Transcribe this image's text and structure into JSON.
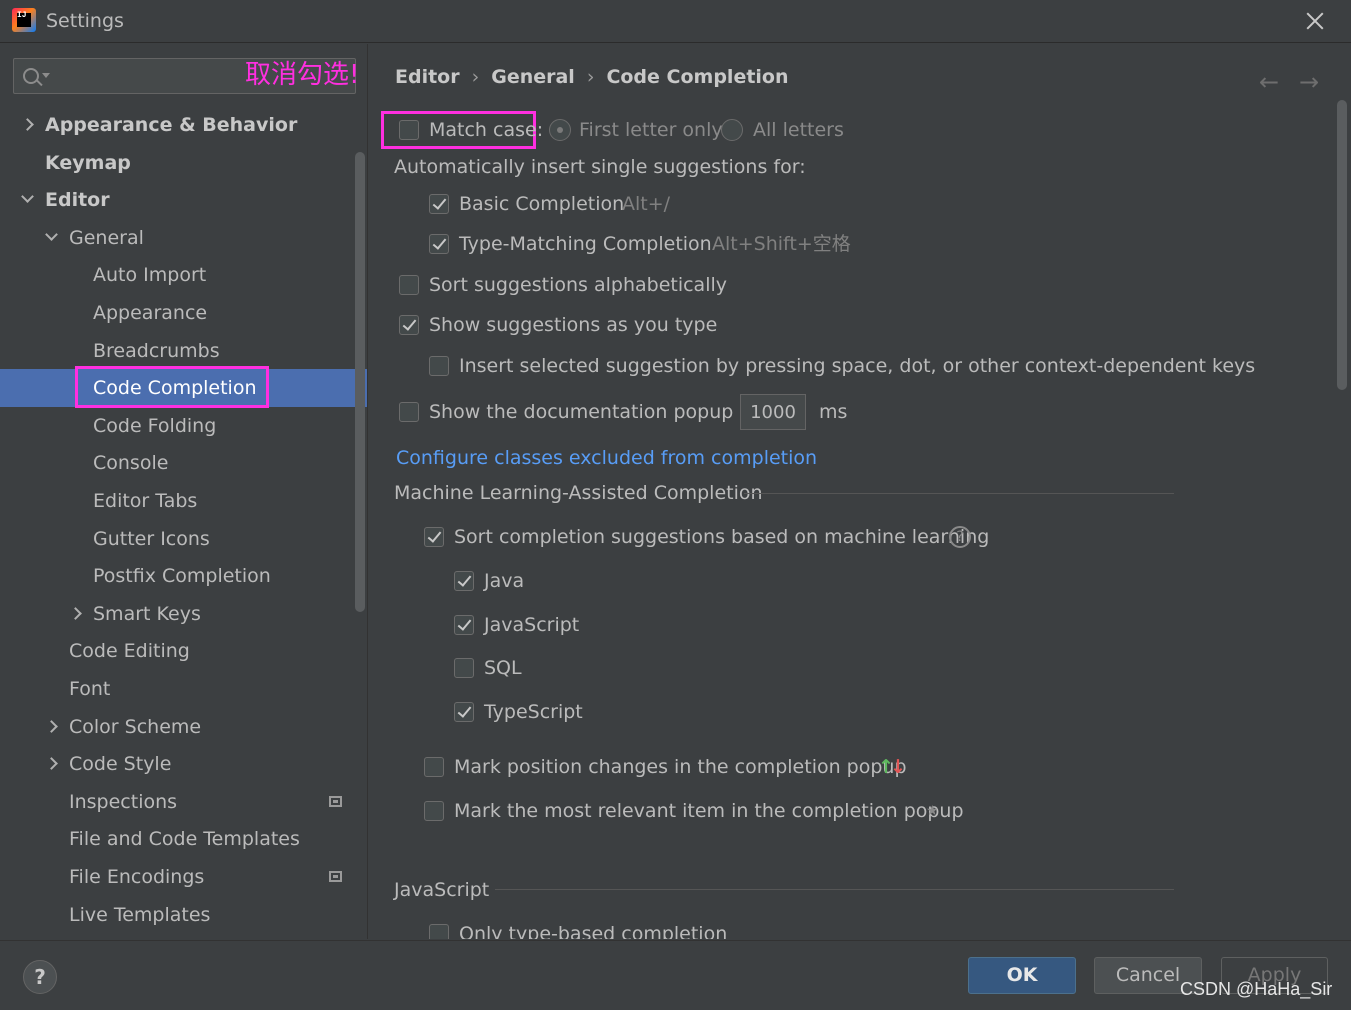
{
  "window": {
    "title": "Settings",
    "app_icon_text": "IJ"
  },
  "annotation": "取消勾选!",
  "search": {
    "value": "",
    "placeholder": ""
  },
  "tree": [
    {
      "label": "Appearance & Behavior",
      "arrow": "right",
      "bold": true
    },
    {
      "label": "Keymap",
      "bold": true
    },
    {
      "label": "Editor",
      "arrow": "down",
      "bold": true
    },
    {
      "label": "General",
      "arrow": "down"
    },
    {
      "label": "Auto Import"
    },
    {
      "label": "Appearance"
    },
    {
      "label": "Breadcrumbs"
    },
    {
      "label": "Code Completion",
      "selected": true
    },
    {
      "label": "Code Folding"
    },
    {
      "label": "Console"
    },
    {
      "label": "Editor Tabs"
    },
    {
      "label": "Gutter Icons"
    },
    {
      "label": "Postfix Completion"
    },
    {
      "label": "Smart Keys",
      "arrow": "right"
    },
    {
      "label": "Code Editing"
    },
    {
      "label": "Font"
    },
    {
      "label": "Color Scheme",
      "arrow": "right"
    },
    {
      "label": "Code Style",
      "arrow": "right"
    },
    {
      "label": "Inspections",
      "badge": "settings-icon"
    },
    {
      "label": "File and Code Templates"
    },
    {
      "label": "File Encodings",
      "badge": "settings-icon"
    },
    {
      "label": "Live Templates"
    }
  ],
  "breadcrumb": [
    "Editor",
    "General",
    "Code Completion"
  ],
  "breadcrumb_sep": "›",
  "nav": {
    "back": "←",
    "forward": "→"
  },
  "options": {
    "match_case": {
      "label": "Match case:",
      "checked": false
    },
    "first_letter_only": {
      "label": "First letter only",
      "selected": true
    },
    "all_letters": {
      "label": "All letters",
      "selected": false
    },
    "auto_insert_heading": "Automatically insert single suggestions for:",
    "basic_completion": {
      "label": "Basic Completion",
      "shortcut": "Alt+/",
      "checked": true
    },
    "type_matching": {
      "label": "Type-Matching Completion",
      "shortcut": "Alt+Shift+空格",
      "checked": true
    },
    "sort_alpha": {
      "label": "Sort suggestions alphabetically",
      "checked": false
    },
    "show_as_you_type": {
      "label": "Show suggestions as you type",
      "checked": true
    },
    "insert_selected": {
      "label": "Insert selected suggestion by pressing space, dot, or other context-dependent keys",
      "checked": false
    },
    "doc_popup": {
      "label": "Show the documentation popup in",
      "value": "1000",
      "unit": "ms",
      "checked": false
    },
    "configure_link": "Configure classes excluded from completion",
    "ml_heading": "Machine Learning-Assisted Completion",
    "ml_sort": {
      "label": "Sort completion suggestions based on machine learning",
      "checked": true
    },
    "help_glyph": "?",
    "ml_java": {
      "label": "Java",
      "checked": true
    },
    "ml_javascript": {
      "label": "JavaScript",
      "checked": true
    },
    "ml_sql": {
      "label": "SQL",
      "checked": false
    },
    "ml_typescript": {
      "label": "TypeScript",
      "checked": true
    },
    "mark_position": {
      "label": "Mark position changes in the completion popup",
      "checked": false,
      "up": "↑",
      "down": "↓"
    },
    "mark_relevant": {
      "label": "Mark the most relevant item in the completion popup",
      "checked": false,
      "star": "★"
    },
    "js_heading": "JavaScript",
    "js_type_based": {
      "label": "Only type-based completion",
      "checked": false
    }
  },
  "footer": {
    "help": "?",
    "ok": "OK",
    "cancel": "Cancel",
    "apply": "Apply",
    "watermark": "CSDN @HaHa_Sir"
  },
  "colors": {
    "background": "#3c3f41",
    "selection": "#4b6eaf",
    "annotation": "#ff2fe0",
    "link": "#589df6",
    "ok_button": "#365880"
  }
}
